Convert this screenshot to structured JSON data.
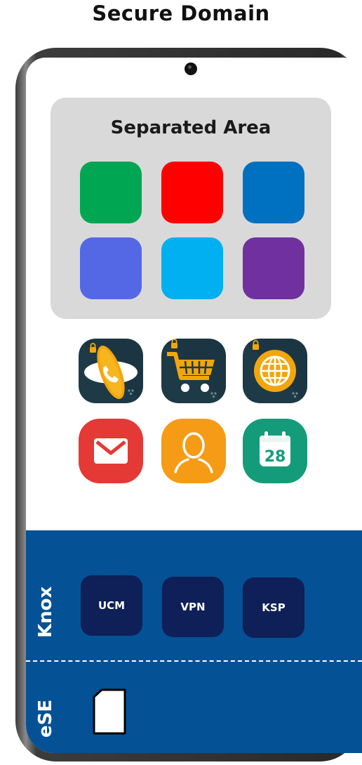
{
  "title": "Secure Domain",
  "separated_area": {
    "label": "Separated Area",
    "tile_colors": [
      "#00a651",
      "#ff0000",
      "#0070c0",
      "#5468e6",
      "#00b0f0",
      "#7030a0"
    ]
  },
  "apps": [
    {
      "icon": "secure-phone-icon"
    },
    {
      "icon": "secure-shopping-cart-icon"
    },
    {
      "icon": "secure-browser-globe-icon"
    },
    {
      "icon": "email-icon"
    },
    {
      "icon": "contacts-icon"
    },
    {
      "icon": "calendar-icon",
      "calendar_day": "28"
    }
  ],
  "knox": {
    "label": "Knox",
    "services": [
      "UCM",
      "VPN",
      "KSP"
    ],
    "band_color": "#055195",
    "service_color": "#0e2057"
  },
  "ese": {
    "label": "eSE",
    "icon": "sim-card-icon"
  }
}
